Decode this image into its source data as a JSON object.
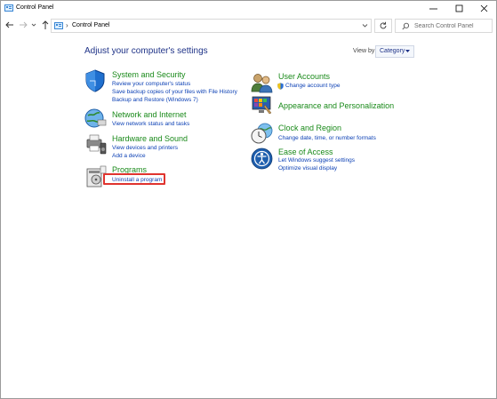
{
  "window": {
    "title": "Control Panel"
  },
  "address_bar": {
    "path": "Control Panel"
  },
  "search": {
    "placeholder": "Search Control Panel"
  },
  "main": {
    "heading": "Adjust your computer's settings",
    "view_by_label": "View by:",
    "view_by_value": "Category"
  },
  "categories_left": [
    {
      "title": "System and Security",
      "icon": "shield-icon",
      "links": [
        "Review your computer's status",
        "Save backup copies of your files with File History",
        "Backup and Restore (Windows 7)"
      ]
    },
    {
      "title": "Network and Internet",
      "icon": "globe-network-icon",
      "links": [
        "View network status and tasks"
      ]
    },
    {
      "title": "Hardware and Sound",
      "icon": "printer-speaker-icon",
      "links": [
        "View devices and printers",
        "Add a device"
      ]
    },
    {
      "title": "Programs",
      "icon": "programs-disc-icon",
      "links": [
        "Uninstall a program"
      ]
    }
  ],
  "categories_right": [
    {
      "title": "User Accounts",
      "icon": "users-icon",
      "links": [
        "Change account type"
      ]
    },
    {
      "title": "Appearance and Personalization",
      "icon": "monitor-palette-icon",
      "links": []
    },
    {
      "title": "Clock and Region",
      "icon": "clock-globe-icon",
      "links": [
        "Change date, time, or number formats"
      ]
    },
    {
      "title": "Ease of Access",
      "icon": "ease-of-access-icon",
      "links": [
        "Let Windows suggest settings",
        "Optimize visual display"
      ]
    }
  ],
  "colors": {
    "heading": "#1e3287",
    "category_title": "#1a8a1a",
    "link": "#0a3fb4",
    "highlight": "#e0342f"
  }
}
